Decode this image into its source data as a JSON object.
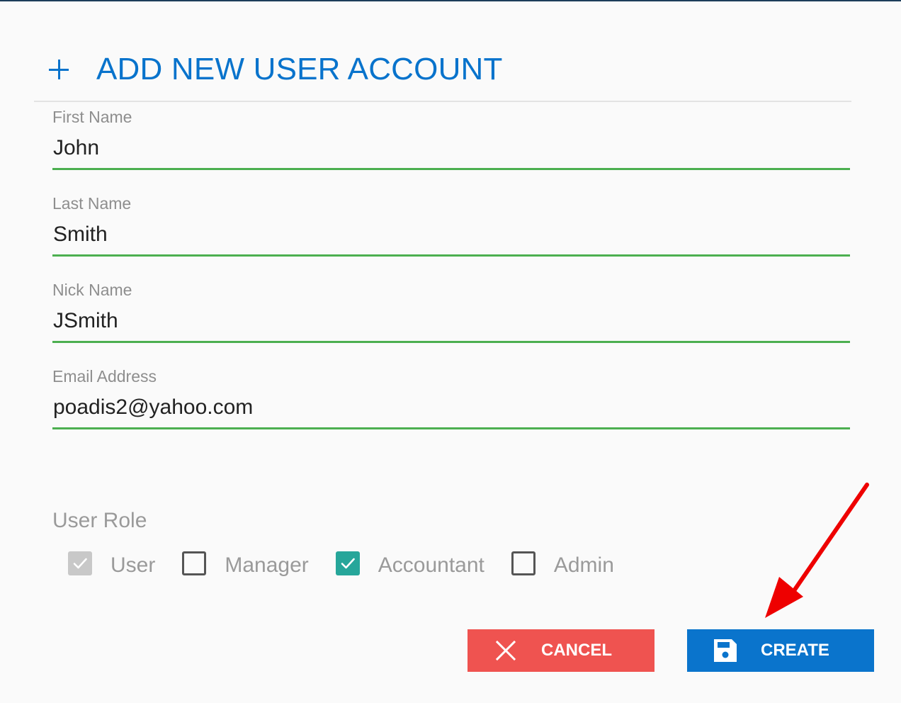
{
  "header": {
    "title": "ADD NEW USER ACCOUNT"
  },
  "form": {
    "fields": [
      {
        "label": "First Name",
        "value": "John"
      },
      {
        "label": "Last Name",
        "value": "Smith"
      },
      {
        "label": "Nick Name",
        "value": "JSmith"
      },
      {
        "label": "Email Address",
        "value": "poadis2@yahoo.com"
      }
    ]
  },
  "roles": {
    "label": "User Role",
    "options": [
      {
        "label": "User",
        "checked": true,
        "disabled": true
      },
      {
        "label": "Manager",
        "checked": false,
        "disabled": false
      },
      {
        "label": "Accountant",
        "checked": true,
        "disabled": false
      },
      {
        "label": "Admin",
        "checked": false,
        "disabled": false
      }
    ]
  },
  "actions": {
    "cancel_label": "CANCEL",
    "create_label": "CREATE"
  },
  "colors": {
    "accent": "#0873cc",
    "input_underline": "#4caf50",
    "checkbox_checked": "#26a69a",
    "cancel_button": "#ef5350",
    "create_button": "#0a74cc",
    "annotation_arrow": "#ee0000"
  },
  "icons": {
    "header": "plus-icon",
    "cancel": "close-icon",
    "create": "save-icon",
    "checkbox": "check-icon"
  }
}
